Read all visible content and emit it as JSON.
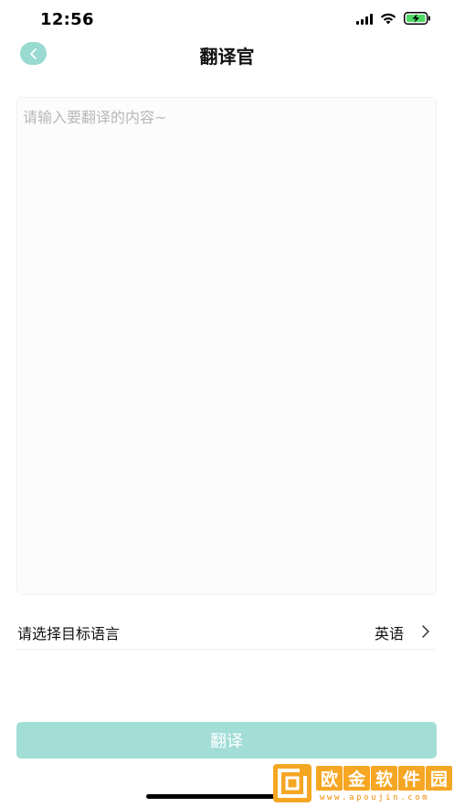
{
  "status_bar": {
    "time": "12:56",
    "icons": [
      "cellular-signal-icon",
      "wifi-icon",
      "battery-charging-icon"
    ]
  },
  "nav": {
    "back_icon": "chevron-left-icon",
    "title": "翻译官"
  },
  "input": {
    "placeholder": "请输入要翻译的内容~",
    "value": ""
  },
  "language_select": {
    "label": "请选择目标语言",
    "value": "英语",
    "icon": "chevron-right-icon"
  },
  "translate_button": {
    "label": "翻译"
  },
  "watermark": {
    "characters": [
      "欧",
      "金",
      "软",
      "件",
      "园"
    ],
    "site": "www.apoujin.com"
  },
  "colors": {
    "accent": "#98d9d0",
    "button_disabled": "#a2ddd6",
    "watermark": "#f5a623"
  }
}
